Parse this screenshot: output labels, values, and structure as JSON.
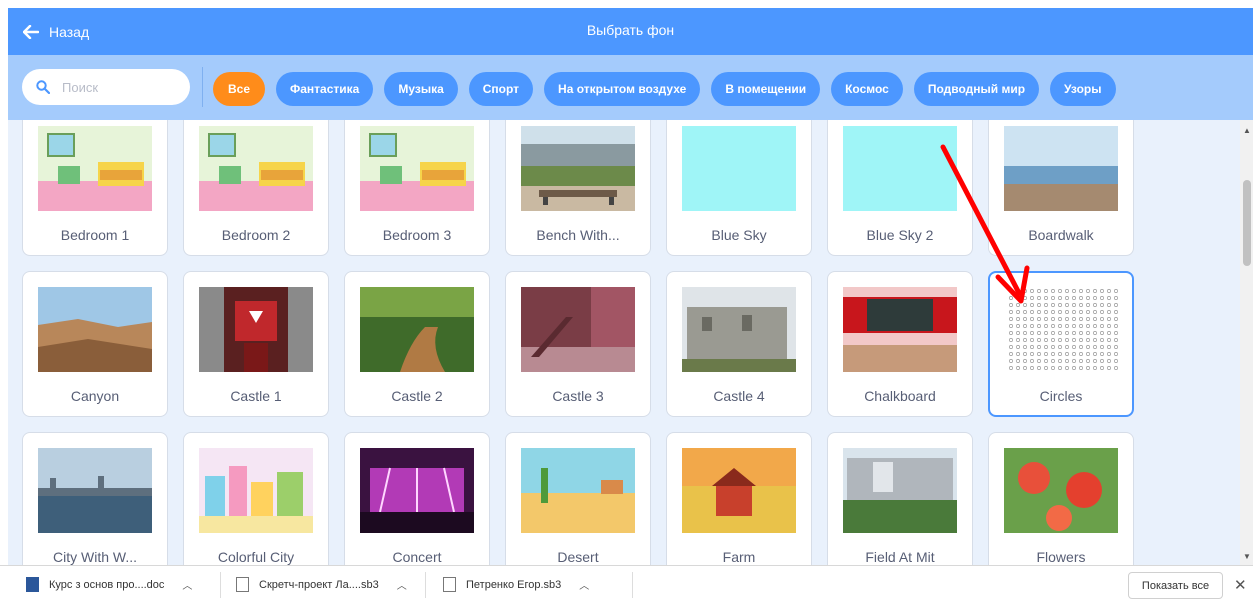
{
  "header": {
    "back_label": "Назад",
    "title": "Выбрать фон"
  },
  "search": {
    "placeholder": "Поиск"
  },
  "tags": [
    {
      "label": "Все",
      "active": true
    },
    {
      "label": "Фантастика"
    },
    {
      "label": "Музыка"
    },
    {
      "label": "Спорт"
    },
    {
      "label": "На открытом воздухе"
    },
    {
      "label": "В помещении"
    },
    {
      "label": "Космос"
    },
    {
      "label": "Подводный мир"
    },
    {
      "label": "Узоры"
    }
  ],
  "backdrops": [
    {
      "name": "Bedroom 1",
      "icon": "bedroom-thumbnail"
    },
    {
      "name": "Bedroom 2",
      "icon": "bedroom-thumbnail"
    },
    {
      "name": "Bedroom 3",
      "icon": "bedroom-thumbnail"
    },
    {
      "name": "Bench With...",
      "icon": "bench-thumbnail"
    },
    {
      "name": "Blue Sky",
      "icon": "sky-thumbnail"
    },
    {
      "name": "Blue Sky 2",
      "icon": "sky-thumbnail"
    },
    {
      "name": "Boardwalk",
      "icon": "boardwalk-thumbnail"
    },
    {
      "name": "Canyon",
      "icon": "canyon-thumbnail"
    },
    {
      "name": "Castle 1",
      "icon": "castle-thumbnail"
    },
    {
      "name": "Castle 2",
      "icon": "forest-path-thumbnail"
    },
    {
      "name": "Castle 3",
      "icon": "castle-hall-thumbnail"
    },
    {
      "name": "Castle 4",
      "icon": "castle-ruins-thumbnail"
    },
    {
      "name": "Chalkboard",
      "icon": "chalkboard-thumbnail"
    },
    {
      "name": "Circles",
      "icon": "circles-pattern-thumbnail",
      "selected": true
    },
    {
      "name": "City With W...",
      "icon": "city-water-thumbnail"
    },
    {
      "name": "Colorful City",
      "icon": "colorful-city-thumbnail"
    },
    {
      "name": "Concert",
      "icon": "concert-thumbnail"
    },
    {
      "name": "Desert",
      "icon": "desert-thumbnail"
    },
    {
      "name": "Farm",
      "icon": "farm-thumbnail"
    },
    {
      "name": "Field At Mit",
      "icon": "field-thumbnail"
    },
    {
      "name": "Flowers",
      "icon": "flowers-thumbnail"
    }
  ],
  "downloads": {
    "items": [
      {
        "label": "Курс з основ про....doc",
        "icon": "word-file-icon"
      },
      {
        "label": "Скретч-проект Ла....sb3",
        "icon": "file-icon"
      },
      {
        "label": "Петренко Егор.sb3",
        "icon": "file-icon"
      }
    ],
    "show_all_label": "Показать все"
  },
  "colors": {
    "header_blue": "#4c97ff",
    "filter_bar": "#a4cbfc",
    "active_tag": "#ff8c1a",
    "annotation_arrow": "#ff0000"
  }
}
